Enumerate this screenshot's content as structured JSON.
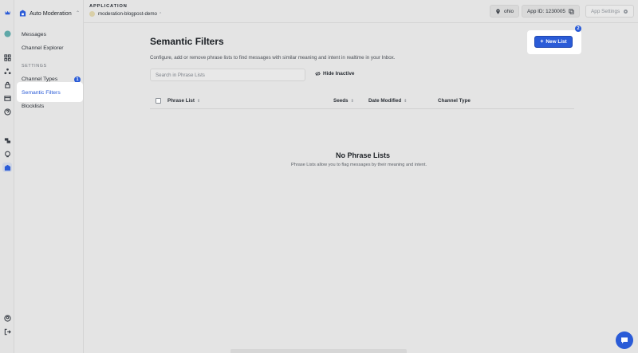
{
  "sidebar": {
    "app_switcher": "Auto Moderation",
    "items": [
      {
        "label": "Messages"
      },
      {
        "label": "Channel Explorer"
      }
    ],
    "section_label": "SETTINGS",
    "settings_items": [
      {
        "label": "Channel Types",
        "badge": "1"
      },
      {
        "label": "Semantic Filters",
        "selected": true
      },
      {
        "label": "Blocklists"
      }
    ]
  },
  "topbar": {
    "app_label": "APPLICATION",
    "app_name": "moderation-blogpost-demo",
    "region": "ohio",
    "app_id": "App ID: 1230005",
    "settings": "App Settings"
  },
  "main": {
    "title": "Semantic Filters",
    "description": "Configure, add or remove phrase lists to find messages with similar meaning and intent in realtime in your Inbox.",
    "new_list_button": "New List",
    "new_list_badge": "2",
    "search_placeholder": "Search in Phrase Lists",
    "hide_inactive": "Hide Inactive",
    "table_columns": [
      "Phrase List",
      "Seeds",
      "Date Modified",
      "Channel Type"
    ],
    "empty_title": "No Phrase Lists",
    "empty_description": "Phrase Lists allow you to flag messages by their meaning and intent."
  },
  "colors": {
    "accent": "#2a5bd7",
    "background": "#e4e4e4"
  }
}
